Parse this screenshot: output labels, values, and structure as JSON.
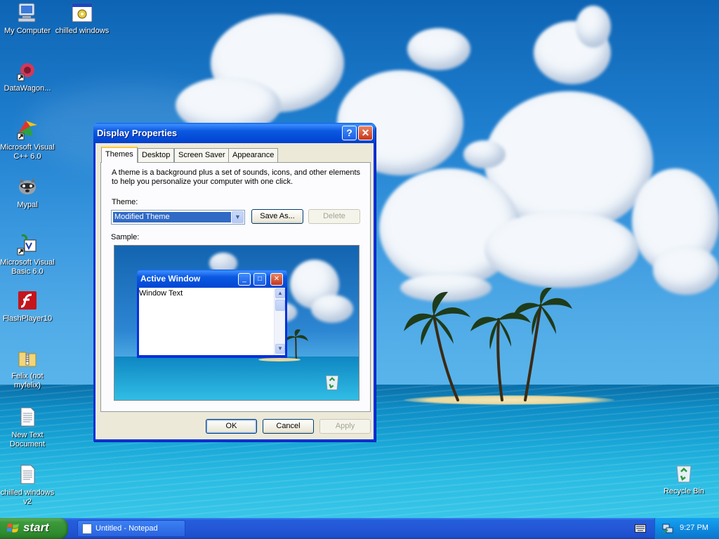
{
  "desktop": {
    "icons": [
      {
        "label": "My Computer",
        "icon": "my-computer-icon"
      },
      {
        "label": "chilled windows",
        "icon": "application-icon"
      },
      {
        "label": "DataWagon...",
        "icon": "datawagon-icon"
      },
      {
        "label": "Microsoft Visual C++ 6.0",
        "icon": "visual-cpp-icon"
      },
      {
        "label": "Mypal",
        "icon": "mypal-icon"
      },
      {
        "label": "Microsoft Visual Basic 6.0",
        "icon": "visual-basic-icon"
      },
      {
        "label": "FlashPlayer10",
        "icon": "flash-player-icon"
      },
      {
        "label": "Felix (not myfelix)",
        "icon": "zip-folder-icon"
      },
      {
        "label": "New Text Document",
        "icon": "text-document-icon"
      },
      {
        "label": "chilled windows v2",
        "icon": "text-document-icon"
      },
      {
        "label": "Recycle Bin",
        "icon": "recycle-bin-icon"
      }
    ]
  },
  "dialog": {
    "title": "Display Properties",
    "help_button": "?",
    "close_button": "✕",
    "tabs": [
      {
        "label": "Themes",
        "active": true
      },
      {
        "label": "Desktop",
        "active": false
      },
      {
        "label": "Screen Saver",
        "active": false
      },
      {
        "label": "Appearance",
        "active": false
      }
    ],
    "description_line1": "A theme is a background plus a set of sounds, icons, and other elements",
    "description_line2": "to help you personalize your computer with one click.",
    "theme_label": "Theme:",
    "theme_value": "Modified Theme",
    "save_as_label": "Save As...",
    "delete_label": "Delete",
    "sample_label": "Sample:",
    "sample": {
      "window_title": "Active Window",
      "window_text": "Window Text"
    },
    "ok_label": "OK",
    "cancel_label": "Cancel",
    "apply_label": "Apply"
  },
  "taskbar": {
    "start_label": "start",
    "task_label": "Untitled - Notepad",
    "clock": "9:27 PM"
  },
  "colors": {
    "title_blue": "#0246d4",
    "start_green": "#3c9a3c",
    "selection_blue": "#316ac5",
    "dialog_face": "#ece9d8"
  }
}
